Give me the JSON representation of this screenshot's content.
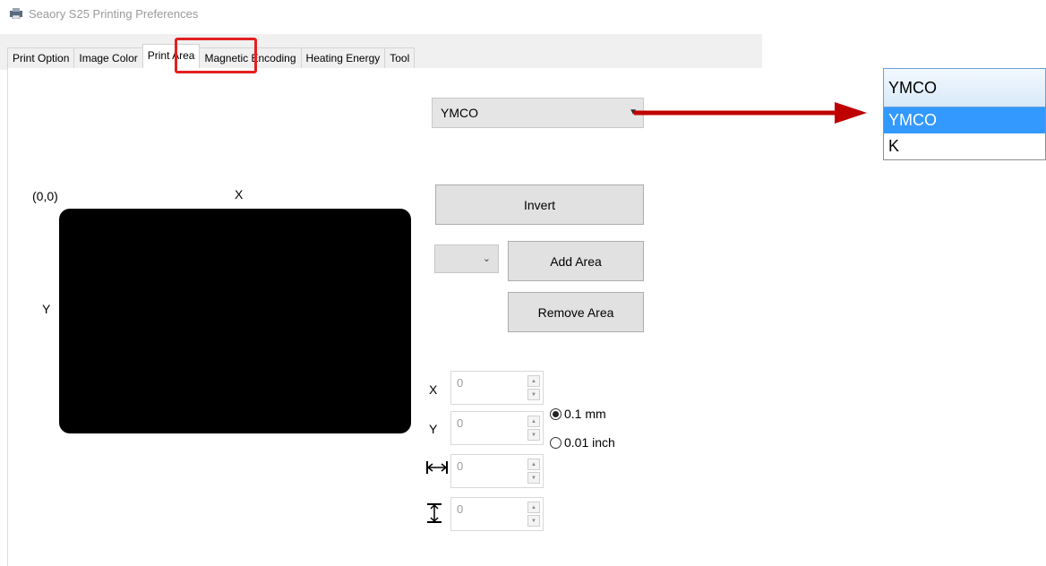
{
  "window": {
    "title": "Seaory S25 Printing Preferences",
    "icon": "printer-icon"
  },
  "tabs": [
    {
      "label": "Print Option",
      "active": false
    },
    {
      "label": "Image Color",
      "active": false
    },
    {
      "label": "Print Area",
      "active": true
    },
    {
      "label": "Magnetic Encoding",
      "active": false
    },
    {
      "label": "Heating Energy",
      "active": false
    },
    {
      "label": "Tool",
      "active": false
    }
  ],
  "print_area": {
    "ribbon_select": "YMCO",
    "origin_label": "(0,0)",
    "x_axis_label": "X",
    "y_axis_label": "Y",
    "invert_label": "Invert",
    "area_select": "",
    "add_area_label": "Add Area",
    "remove_area_label": "Remove Area",
    "fields": {
      "x_label": "X",
      "x_value": "0",
      "y_label": "Y",
      "y_value": "0",
      "width_value": "0",
      "height_value": "0"
    },
    "units": [
      {
        "label": "0.1 mm",
        "checked": true
      },
      {
        "label": "0.01 inch",
        "checked": false
      }
    ]
  },
  "dropdown_zoom": {
    "selected": "YMCO",
    "options": [
      "YMCO",
      "K"
    ],
    "highlighted_index": 0
  },
  "colors": {
    "tab_highlight": "#e32020",
    "callout_arrow": "#c00000",
    "option_highlight": "#3399ff"
  }
}
